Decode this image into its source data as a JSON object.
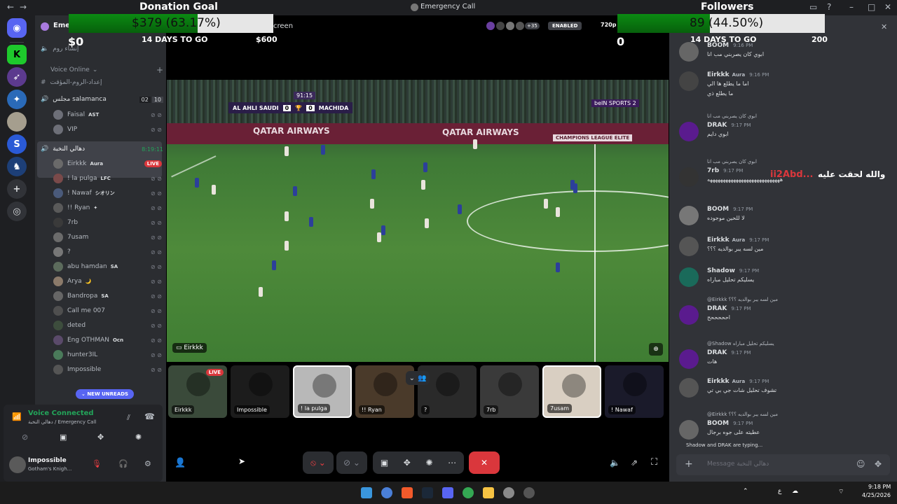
{
  "window": {
    "title": "Emergency Call",
    "back_label": "←",
    "forward_label": "→"
  },
  "server": {
    "name": "Emer",
    "create_room_label": "إنشاء روم"
  },
  "sidebar": {
    "category": "Voice Online",
    "temp_channel": "إعداد-الروم-المؤقت",
    "channel_1": {
      "name": "مجلس salamanca",
      "count_a": "02",
      "count_b": "10"
    },
    "channel_1_users": [
      {
        "name": "Faisal",
        "tag": "AST"
      },
      {
        "name": "VIP",
        "tag": ""
      }
    ],
    "channel_2": {
      "name": "دهالي النخبة",
      "timer": "8:19:11"
    },
    "channel_2_users": [
      {
        "name": "Eirkkk",
        "tag": "Aura",
        "live": "LIVE"
      },
      {
        "name": "! la pulga",
        "tag": "LFC"
      },
      {
        "name": "! Nawaf",
        "tag": "シオリン"
      },
      {
        "name": "!! Ryan",
        "tag": "✦"
      },
      {
        "name": "7rb",
        "tag": ""
      },
      {
        "name": "7usam",
        "tag": ""
      },
      {
        "name": "?",
        "tag": ""
      },
      {
        "name": "abu hamdan",
        "tag": "SA"
      },
      {
        "name": "Arya",
        "tag": "🌙"
      },
      {
        "name": "Bandropa",
        "tag": "SA"
      },
      {
        "name": "Call me 007",
        "tag": ""
      },
      {
        "name": "deted",
        "tag": ""
      },
      {
        "name": "Eng OTHMAN",
        "tag": "Ocn"
      },
      {
        "name": "hunter3IL",
        "tag": ""
      },
      {
        "name": "Impossible",
        "tag": ""
      }
    ],
    "new_unreads": "NEW UNREADS"
  },
  "voice_panel": {
    "status": "Voice Connected",
    "location": "دهالي النخبة / Emergency Call",
    "user_name": "Impossible",
    "user_status": "Gotham's Knigh..."
  },
  "stage": {
    "screen_share_label": "creen",
    "enabled_badge": "ENABLED",
    "quality": "720p",
    "participant_count": "+35",
    "streamer_label": "Eirkkk",
    "scoreboard": {
      "time": "91:15",
      "home": "AL AHLI SAUDI",
      "home_score": "0",
      "away_score": "0",
      "away": "MACHIDA"
    },
    "ad_text": "QATAR AIRWAYS",
    "ad_text_2": "CHAMPIONS LEAGUE ELITE",
    "broadcaster": "beIN SPORTS 2"
  },
  "thumbs": [
    {
      "label": "Eirkkk",
      "live": "LIVE"
    },
    {
      "label": "Impossible"
    },
    {
      "label": "! la pulga"
    },
    {
      "label": "!! Ryan"
    },
    {
      "label": "?"
    },
    {
      "label": "7rb"
    },
    {
      "label": "7usam"
    },
    {
      "label": "! Nawaf"
    }
  ],
  "overlay": {
    "donation": {
      "title": "Donation Goal",
      "value": "$379 (63.17%)",
      "current": "$0",
      "days": "14 DAYS TO GO",
      "target": "$600",
      "progress": 0.6317
    },
    "followers": {
      "title": "Followers",
      "value": "89 (44.50%)",
      "current": "0",
      "days": "14 DAYS TO GO",
      "target": "200",
      "progress": 0.445
    }
  },
  "chat": {
    "messages": [
      {
        "name": "BOOM",
        "time": "9:16 PM",
        "text": "ابوي كان يصربني مب انا"
      },
      {
        "name": "Eirkkk",
        "tag": "Aura",
        "time": "9:16 PM",
        "text": "اما ما يطلع ها الي",
        "text2": "ما يطلع ذي"
      },
      {
        "reply": "ابوي كان يصربني مب انا",
        "name": "DRAK",
        "time": "9:17 PM",
        "text": "ابوي دايم"
      },
      {
        "reply": "ابوي كان يصربني مب انا",
        "name": "7rb",
        "time": "9:17 PM",
        "text": "ههههههههههههههههههههههههههههه",
        "side": "والله لحقت عليه",
        "side_name": "ii2Abd..."
      },
      {
        "name": "BOOM",
        "time": "9:17 PM",
        "text": "لا للحين موجوده"
      },
      {
        "name": "Eirkkk",
        "tag": "Aura",
        "time": "9:17 PM",
        "text": "مين لسه يبر بوالديه ؟؟؟"
      },
      {
        "name": "Shadow",
        "time": "9:17 PM",
        "text": "يسليكم تحليل مباراه"
      },
      {
        "reply": "@Eirkkk مين لسه يبر بوالديه ؟؟؟",
        "name": "DRAK",
        "time": "9:17 PM",
        "text": "احححححح"
      },
      {
        "reply": "@Shadow يسليكم تحليل مباراه",
        "name": "DRAK",
        "time": "9:17 PM",
        "text": "هات"
      },
      {
        "name": "Eirkkk",
        "tag": "Aura",
        "time": "9:17 PM",
        "text": "تشوف تحليل شات جي بي تي"
      },
      {
        "reply": "@Eirkkk مين لسه يبر بوالديه ؟؟؟",
        "name": "BOOM",
        "time": "9:17 PM",
        "text": "عطيته على جوه برجال"
      }
    ],
    "typing": "Shadow and DRAK are typing...",
    "input_placeholder": "Message دهالي النخبة"
  },
  "taskbar": {
    "time": "9:18 PM",
    "date": "4/25/2026",
    "lang": "ع"
  }
}
